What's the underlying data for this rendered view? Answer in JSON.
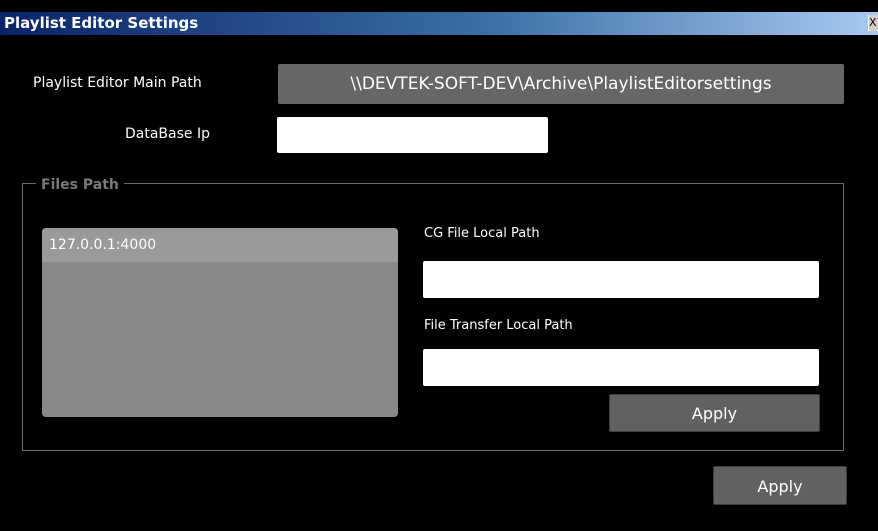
{
  "window": {
    "title": "Playlist Editor Settings",
    "close_glyph": "X"
  },
  "main_path": {
    "label": "Playlist Editor Main Path",
    "value": "\\\\DEVTEK-SOFT-DEV\\Archive\\PlaylistEditorsettings"
  },
  "database_ip": {
    "label": "DataBase Ip",
    "value": ""
  },
  "files_path": {
    "group_title": "Files Path",
    "list_items": [
      "127.0.0.1:4000"
    ],
    "cg_label": "CG File Local Path",
    "cg_value": "",
    "transfer_label": "File Transfer Local Path",
    "transfer_value": "",
    "apply_label": "Apply"
  },
  "footer": {
    "apply_label": "Apply"
  },
  "colors": {
    "background": "#000000",
    "titlebar_start": "#0a246a",
    "titlebar_end": "#a6caf0",
    "path_box": "#666666",
    "listbox": "#888888",
    "list_item_selected": "#9a9a9a",
    "button": "#616161",
    "group_border": "#6d6d6d",
    "group_title": "#7a7a7a"
  }
}
